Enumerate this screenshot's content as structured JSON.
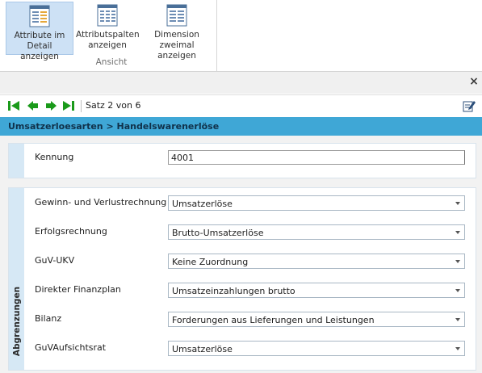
{
  "ribbon": {
    "buttons": [
      {
        "label": "Attribute im Detail anzeigen",
        "line1": "Attribute im",
        "line2": "Detail anzeigen",
        "active": true
      },
      {
        "label": "Attributspalten anzeigen",
        "line1": "Attributspalten",
        "line2": "anzeigen",
        "active": false
      },
      {
        "label": "Dimension zweimal anzeigen",
        "line1": "Dimension",
        "line2": "zweimal anzeigen",
        "active": false
      }
    ],
    "group_label": "Ansicht"
  },
  "close_label": "×",
  "nav": {
    "record_text": "Satz 2 von 6",
    "icons": [
      "first-record-icon",
      "previous-record-icon",
      "next-record-icon",
      "last-record-icon",
      "edit-icon"
    ],
    "accent_color": "#1a9a1a"
  },
  "title": "Umsatzerloesarten > Handelswarenerlöse",
  "title_color": "#3fa7d6",
  "kennung": {
    "label": "Kennung",
    "value": "4001"
  },
  "section": {
    "label": "Abgrenzungen",
    "fields": [
      {
        "label": "Gewinn- und Verlustrechnung",
        "value": "Umsatzerlöse"
      },
      {
        "label": "Erfolgsrechnung",
        "value": "Brutto-Umsatzerlöse"
      },
      {
        "label": "GuV-UKV",
        "value": "Keine Zuordnung"
      },
      {
        "label": "Direkter Finanzplan",
        "value": "Umsatzeinzahlungen brutto"
      },
      {
        "label": "Bilanz",
        "value": "Forderungen aus Lieferungen und Leistungen"
      },
      {
        "label": "GuVAufsichtsrat",
        "value": "Umsatzerlöse"
      }
    ]
  }
}
